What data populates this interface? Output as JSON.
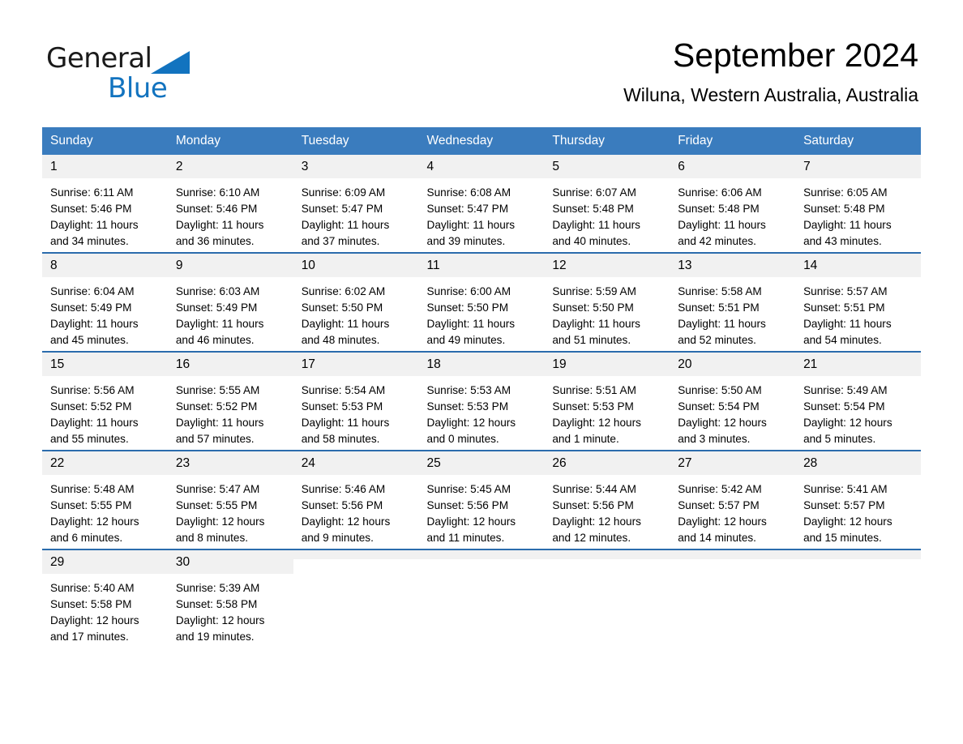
{
  "brand": {
    "name_part1": "General",
    "name_part2": "Blue",
    "logo_icon": "triangle-logo-icon",
    "accent_color": "#1273bf"
  },
  "header": {
    "month_title": "September 2024",
    "location": "Wiluna, Western Australia, Australia"
  },
  "colors": {
    "header_row_bg": "#3a7cbe",
    "row_divider": "#2b6cad",
    "day_number_bg": "#f1f1f1",
    "text": "#000000"
  },
  "calendar": {
    "weekday_headers": [
      "Sunday",
      "Monday",
      "Tuesday",
      "Wednesday",
      "Thursday",
      "Friday",
      "Saturday"
    ],
    "weeks": [
      [
        {
          "day": "1",
          "sunrise": "Sunrise: 6:11 AM",
          "sunset": "Sunset: 5:46 PM",
          "daylight_line1": "Daylight: 11 hours",
          "daylight_line2": "and 34 minutes."
        },
        {
          "day": "2",
          "sunrise": "Sunrise: 6:10 AM",
          "sunset": "Sunset: 5:46 PM",
          "daylight_line1": "Daylight: 11 hours",
          "daylight_line2": "and 36 minutes."
        },
        {
          "day": "3",
          "sunrise": "Sunrise: 6:09 AM",
          "sunset": "Sunset: 5:47 PM",
          "daylight_line1": "Daylight: 11 hours",
          "daylight_line2": "and 37 minutes."
        },
        {
          "day": "4",
          "sunrise": "Sunrise: 6:08 AM",
          "sunset": "Sunset: 5:47 PM",
          "daylight_line1": "Daylight: 11 hours",
          "daylight_line2": "and 39 minutes."
        },
        {
          "day": "5",
          "sunrise": "Sunrise: 6:07 AM",
          "sunset": "Sunset: 5:48 PM",
          "daylight_line1": "Daylight: 11 hours",
          "daylight_line2": "and 40 minutes."
        },
        {
          "day": "6",
          "sunrise": "Sunrise: 6:06 AM",
          "sunset": "Sunset: 5:48 PM",
          "daylight_line1": "Daylight: 11 hours",
          "daylight_line2": "and 42 minutes."
        },
        {
          "day": "7",
          "sunrise": "Sunrise: 6:05 AM",
          "sunset": "Sunset: 5:48 PM",
          "daylight_line1": "Daylight: 11 hours",
          "daylight_line2": "and 43 minutes."
        }
      ],
      [
        {
          "day": "8",
          "sunrise": "Sunrise: 6:04 AM",
          "sunset": "Sunset: 5:49 PM",
          "daylight_line1": "Daylight: 11 hours",
          "daylight_line2": "and 45 minutes."
        },
        {
          "day": "9",
          "sunrise": "Sunrise: 6:03 AM",
          "sunset": "Sunset: 5:49 PM",
          "daylight_line1": "Daylight: 11 hours",
          "daylight_line2": "and 46 minutes."
        },
        {
          "day": "10",
          "sunrise": "Sunrise: 6:02 AM",
          "sunset": "Sunset: 5:50 PM",
          "daylight_line1": "Daylight: 11 hours",
          "daylight_line2": "and 48 minutes."
        },
        {
          "day": "11",
          "sunrise": "Sunrise: 6:00 AM",
          "sunset": "Sunset: 5:50 PM",
          "daylight_line1": "Daylight: 11 hours",
          "daylight_line2": "and 49 minutes."
        },
        {
          "day": "12",
          "sunrise": "Sunrise: 5:59 AM",
          "sunset": "Sunset: 5:50 PM",
          "daylight_line1": "Daylight: 11 hours",
          "daylight_line2": "and 51 minutes."
        },
        {
          "day": "13",
          "sunrise": "Sunrise: 5:58 AM",
          "sunset": "Sunset: 5:51 PM",
          "daylight_line1": "Daylight: 11 hours",
          "daylight_line2": "and 52 minutes."
        },
        {
          "day": "14",
          "sunrise": "Sunrise: 5:57 AM",
          "sunset": "Sunset: 5:51 PM",
          "daylight_line1": "Daylight: 11 hours",
          "daylight_line2": "and 54 minutes."
        }
      ],
      [
        {
          "day": "15",
          "sunrise": "Sunrise: 5:56 AM",
          "sunset": "Sunset: 5:52 PM",
          "daylight_line1": "Daylight: 11 hours",
          "daylight_line2": "and 55 minutes."
        },
        {
          "day": "16",
          "sunrise": "Sunrise: 5:55 AM",
          "sunset": "Sunset: 5:52 PM",
          "daylight_line1": "Daylight: 11 hours",
          "daylight_line2": "and 57 minutes."
        },
        {
          "day": "17",
          "sunrise": "Sunrise: 5:54 AM",
          "sunset": "Sunset: 5:53 PM",
          "daylight_line1": "Daylight: 11 hours",
          "daylight_line2": "and 58 minutes."
        },
        {
          "day": "18",
          "sunrise": "Sunrise: 5:53 AM",
          "sunset": "Sunset: 5:53 PM",
          "daylight_line1": "Daylight: 12 hours",
          "daylight_line2": "and 0 minutes."
        },
        {
          "day": "19",
          "sunrise": "Sunrise: 5:51 AM",
          "sunset": "Sunset: 5:53 PM",
          "daylight_line1": "Daylight: 12 hours",
          "daylight_line2": "and 1 minute."
        },
        {
          "day": "20",
          "sunrise": "Sunrise: 5:50 AM",
          "sunset": "Sunset: 5:54 PM",
          "daylight_line1": "Daylight: 12 hours",
          "daylight_line2": "and 3 minutes."
        },
        {
          "day": "21",
          "sunrise": "Sunrise: 5:49 AM",
          "sunset": "Sunset: 5:54 PM",
          "daylight_line1": "Daylight: 12 hours",
          "daylight_line2": "and 5 minutes."
        }
      ],
      [
        {
          "day": "22",
          "sunrise": "Sunrise: 5:48 AM",
          "sunset": "Sunset: 5:55 PM",
          "daylight_line1": "Daylight: 12 hours",
          "daylight_line2": "and 6 minutes."
        },
        {
          "day": "23",
          "sunrise": "Sunrise: 5:47 AM",
          "sunset": "Sunset: 5:55 PM",
          "daylight_line1": "Daylight: 12 hours",
          "daylight_line2": "and 8 minutes."
        },
        {
          "day": "24",
          "sunrise": "Sunrise: 5:46 AM",
          "sunset": "Sunset: 5:56 PM",
          "daylight_line1": "Daylight: 12 hours",
          "daylight_line2": "and 9 minutes."
        },
        {
          "day": "25",
          "sunrise": "Sunrise: 5:45 AM",
          "sunset": "Sunset: 5:56 PM",
          "daylight_line1": "Daylight: 12 hours",
          "daylight_line2": "and 11 minutes."
        },
        {
          "day": "26",
          "sunrise": "Sunrise: 5:44 AM",
          "sunset": "Sunset: 5:56 PM",
          "daylight_line1": "Daylight: 12 hours",
          "daylight_line2": "and 12 minutes."
        },
        {
          "day": "27",
          "sunrise": "Sunrise: 5:42 AM",
          "sunset": "Sunset: 5:57 PM",
          "daylight_line1": "Daylight: 12 hours",
          "daylight_line2": "and 14 minutes."
        },
        {
          "day": "28",
          "sunrise": "Sunrise: 5:41 AM",
          "sunset": "Sunset: 5:57 PM",
          "daylight_line1": "Daylight: 12 hours",
          "daylight_line2": "and 15 minutes."
        }
      ],
      [
        {
          "day": "29",
          "sunrise": "Sunrise: 5:40 AM",
          "sunset": "Sunset: 5:58 PM",
          "daylight_line1": "Daylight: 12 hours",
          "daylight_line2": "and 17 minutes."
        },
        {
          "day": "30",
          "sunrise": "Sunrise: 5:39 AM",
          "sunset": "Sunset: 5:58 PM",
          "daylight_line1": "Daylight: 12 hours",
          "daylight_line2": "and 19 minutes."
        },
        {
          "day": "",
          "sunrise": "",
          "sunset": "",
          "daylight_line1": "",
          "daylight_line2": ""
        },
        {
          "day": "",
          "sunrise": "",
          "sunset": "",
          "daylight_line1": "",
          "daylight_line2": ""
        },
        {
          "day": "",
          "sunrise": "",
          "sunset": "",
          "daylight_line1": "",
          "daylight_line2": ""
        },
        {
          "day": "",
          "sunrise": "",
          "sunset": "",
          "daylight_line1": "",
          "daylight_line2": ""
        },
        {
          "day": "",
          "sunrise": "",
          "sunset": "",
          "daylight_line1": "",
          "daylight_line2": ""
        }
      ]
    ]
  }
}
